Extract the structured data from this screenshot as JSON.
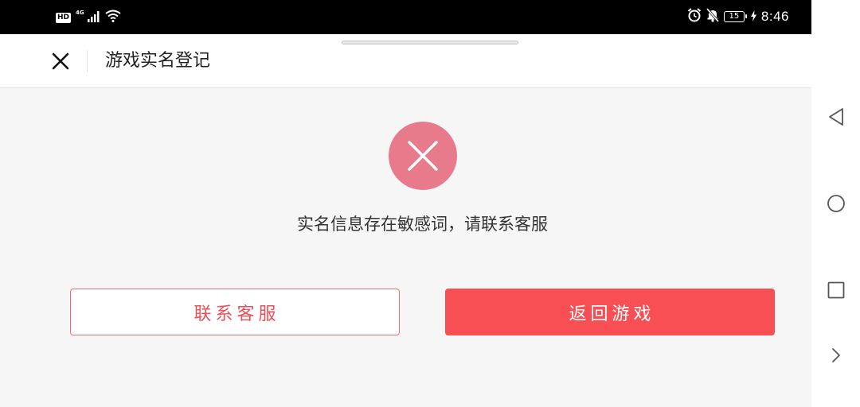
{
  "status_bar": {
    "hd_label": "HD",
    "network_label": "4G",
    "battery_level": "15",
    "time": "8:46",
    "icons": [
      "hd-icon",
      "signal-icon",
      "wifi-icon",
      "alarm-icon",
      "mute-icon",
      "battery-icon",
      "charging-icon"
    ]
  },
  "header": {
    "title": "游戏实名登记",
    "close_icon": "close-icon"
  },
  "content": {
    "status_icon": "error-x-icon",
    "status_color": "#e77b8c",
    "message": "实名信息存在敏感词，请联系客服"
  },
  "actions": {
    "contact_label": "联系客服",
    "return_label": "返回游戏",
    "primary_color": "#f74f53"
  },
  "nav_bar": {
    "icons": [
      "back-triangle-icon",
      "home-circle-icon",
      "recents-square-icon",
      "chevron-right-icon"
    ]
  }
}
